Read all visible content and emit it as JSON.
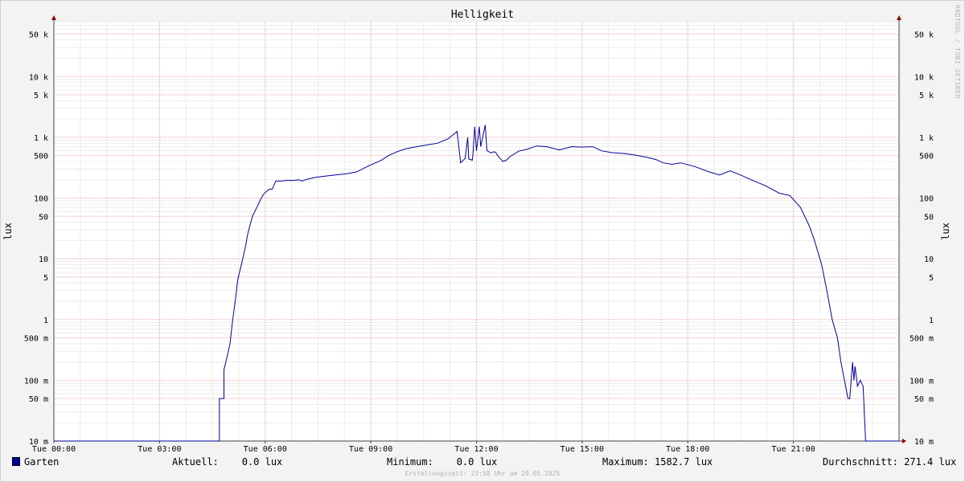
{
  "chart_data": {
    "type": "line",
    "title": "Helligkeit",
    "ylabel": "lux",
    "yscale": "log",
    "ylim": [
      0.01,
      80000
    ],
    "xlim": [
      "Tue 00:00",
      "Wed 00:00"
    ],
    "grid": true,
    "legend_position": "bottom-left",
    "x_tick_labels": [
      "Tue 00:00",
      "Tue 03:00",
      "Tue 06:00",
      "Tue 09:00",
      "Tue 12:00",
      "Tue 15:00",
      "Tue 18:00",
      "Tue 21:00"
    ],
    "y_ticks": [
      {
        "value": 50000,
        "label": "50 k"
      },
      {
        "value": 10000,
        "label": "10 k"
      },
      {
        "value": 5000,
        "label": "5 k"
      },
      {
        "value": 1000,
        "label": "1 k"
      },
      {
        "value": 500,
        "label": "500"
      },
      {
        "value": 100,
        "label": "100"
      },
      {
        "value": 50,
        "label": "50"
      },
      {
        "value": 10,
        "label": "10"
      },
      {
        "value": 5,
        "label": "5"
      },
      {
        "value": 1,
        "label": "1"
      },
      {
        "value": 0.5,
        "label": "500 m"
      },
      {
        "value": 0.1,
        "label": "100 m"
      },
      {
        "value": 0.05,
        "label": "50 m"
      },
      {
        "value": 0.01,
        "label": "10 m"
      }
    ],
    "series": [
      {
        "name": "Garten",
        "color": "#00009c",
        "x_hours": [
          0,
          4.7,
          4.7,
          4.83,
          4.83,
          4.9,
          5.0,
          5.07,
          5.15,
          5.22,
          5.3,
          5.38,
          5.45,
          5.5,
          5.58,
          5.65,
          5.72,
          5.85,
          5.95,
          6.05,
          6.12,
          6.2,
          6.3,
          6.45,
          6.6,
          6.8,
          6.95,
          7.05,
          7.2,
          7.45,
          7.7,
          8.0,
          8.3,
          8.6,
          8.9,
          9.3,
          9.5,
          9.75,
          10.0,
          10.3,
          10.6,
          10.9,
          11.2,
          11.45,
          11.55,
          11.68,
          11.75,
          11.78,
          11.88,
          11.9,
          11.95,
          12.0,
          12.08,
          12.12,
          12.25,
          12.3,
          12.42,
          12.5,
          12.55,
          12.62,
          12.72,
          12.75,
          12.85,
          12.95,
          13.2,
          13.45,
          13.7,
          14.0,
          14.35,
          14.7,
          15.0,
          15.3,
          15.55,
          15.85,
          16.2,
          16.5,
          16.9,
          17.1,
          17.3,
          17.55,
          17.8,
          18.2,
          18.6,
          18.9,
          19.2,
          19.5,
          19.8,
          20.2,
          20.6,
          20.9,
          21.2,
          21.45,
          21.6,
          21.8,
          21.95,
          22.1,
          22.25,
          22.35,
          22.45,
          22.55,
          22.6,
          22.68,
          22.72,
          22.75,
          22.82,
          22.9,
          22.98,
          23.05,
          23.1,
          23.15,
          23.2,
          23.22,
          24.0
        ],
        "y_lux": [
          0.01,
          0.01,
          0.05,
          0.05,
          0.15,
          0.22,
          0.4,
          0.9,
          2,
          4.5,
          7,
          11,
          17,
          25,
          38,
          52,
          62,
          90,
          115,
          130,
          140,
          140,
          190,
          190,
          195,
          195,
          200,
          190,
          205,
          220,
          230,
          240,
          250,
          270,
          330,
          420,
          500,
          580,
          650,
          700,
          750,
          800,
          950,
          1250,
          380,
          450,
          1000,
          440,
          420,
          520,
          1500,
          600,
          1500,
          700,
          1600,
          600,
          550,
          580,
          560,
          480,
          420,
          400,
          420,
          480,
          590,
          640,
          720,
          700,
          620,
          700,
          690,
          700,
          600,
          560,
          540,
          510,
          460,
          430,
          380,
          360,
          380,
          330,
          270,
          240,
          280,
          240,
          200,
          160,
          120,
          110,
          70,
          35,
          20,
          8,
          3,
          1,
          0.5,
          0.2,
          0.1,
          0.05,
          0.05,
          0.2,
          0.1,
          0.17,
          0.08,
          0.1,
          0.08,
          0.01,
          0.01,
          0.01,
          0.01,
          0.01,
          0.01,
          0.01,
          0.01
        ]
      }
    ]
  },
  "watermark": "RRDTOOL / TOBI OETIKER",
  "legend": {
    "series_name": "Garten",
    "current": "Aktuell:    0.0 lux",
    "minimum": "Minimum:    0.0 lux",
    "maximum": "Maximum: 1582.7 lux",
    "average": "Durchschnitt: 271.4 lux"
  },
  "footer": "Erstellungszeit: 23:58 Uhr am 20.05.2025"
}
